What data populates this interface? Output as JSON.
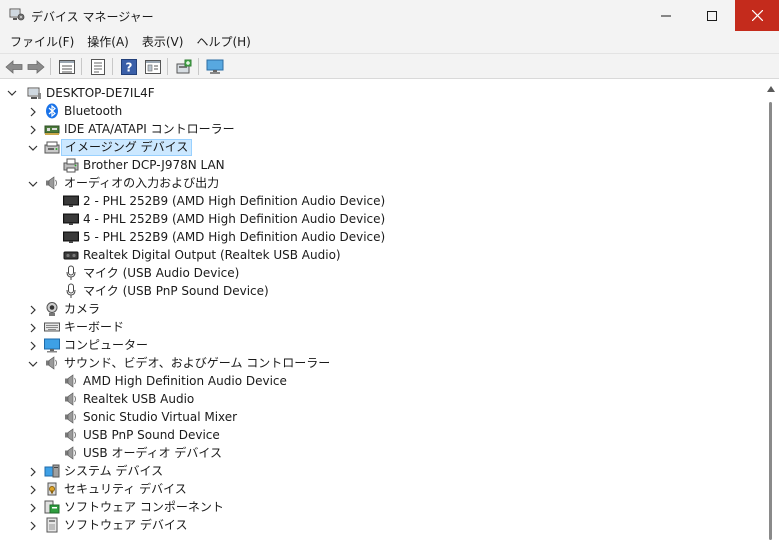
{
  "window": {
    "title": "デバイス マネージャー"
  },
  "menu": [
    "ファイル(F)",
    "操作(A)",
    "表示(V)",
    "ヘルプ(H)"
  ],
  "toolbar": [
    "back-icon",
    "forward-icon",
    "properties-icon",
    "update-driver-icon",
    "help-icon",
    "view-icon",
    "scan-hardware-icon",
    "monitor-icon"
  ],
  "tree": {
    "root": {
      "label": "DESKTOP-DE7IL4F",
      "icon": "computer-icon"
    },
    "items": [
      {
        "label": "Bluetooth",
        "level": 1,
        "expander": "collapsed",
        "icon": "bluetooth-icon"
      },
      {
        "label": "IDE ATA/ATAPI コントローラー",
        "level": 1,
        "expander": "collapsed",
        "icon": "ide-controller-icon"
      },
      {
        "label": "イメージング デバイス",
        "level": 1,
        "expander": "expanded",
        "icon": "imaging-device-icon",
        "selected": true
      },
      {
        "label": "Brother DCP-J978N LAN",
        "level": 2,
        "expander": "none",
        "icon": "printer-icon"
      },
      {
        "label": "オーディオの入力および出力",
        "level": 1,
        "expander": "expanded",
        "icon": "speaker-icon"
      },
      {
        "label": "2 - PHL 252B9 (AMD High Definition Audio Device)",
        "level": 2,
        "expander": "none",
        "icon": "monitor-audio-icon"
      },
      {
        "label": "4 - PHL 252B9 (AMD High Definition Audio Device)",
        "level": 2,
        "expander": "none",
        "icon": "monitor-audio-icon"
      },
      {
        "label": "5 - PHL 252B9 (AMD High Definition Audio Device)",
        "level": 2,
        "expander": "none",
        "icon": "monitor-audio-icon"
      },
      {
        "label": "Realtek Digital Output (Realtek USB Audio)",
        "level": 2,
        "expander": "none",
        "icon": "digital-output-icon"
      },
      {
        "label": "マイク (USB Audio Device)",
        "level": 2,
        "expander": "none",
        "icon": "microphone-icon"
      },
      {
        "label": "マイク (USB PnP Sound Device)",
        "level": 2,
        "expander": "none",
        "icon": "microphone-icon"
      },
      {
        "label": "カメラ",
        "level": 1,
        "expander": "collapsed",
        "icon": "camera-icon"
      },
      {
        "label": "キーボード",
        "level": 1,
        "expander": "collapsed",
        "icon": "keyboard-icon"
      },
      {
        "label": "コンピューター",
        "level": 1,
        "expander": "collapsed",
        "icon": "computer-display-icon"
      },
      {
        "label": "サウンド、ビデオ、およびゲーム コントローラー",
        "level": 1,
        "expander": "expanded",
        "icon": "speaker-icon"
      },
      {
        "label": "AMD High Definition Audio Device",
        "level": 2,
        "expander": "none",
        "icon": "speaker-icon"
      },
      {
        "label": "Realtek USB Audio",
        "level": 2,
        "expander": "none",
        "icon": "speaker-icon"
      },
      {
        "label": "Sonic Studio Virtual Mixer",
        "level": 2,
        "expander": "none",
        "icon": "speaker-icon"
      },
      {
        "label": "USB PnP Sound Device",
        "level": 2,
        "expander": "none",
        "icon": "speaker-icon"
      },
      {
        "label": "USB オーディオ デバイス",
        "level": 2,
        "expander": "none",
        "icon": "speaker-icon"
      },
      {
        "label": "システム デバイス",
        "level": 1,
        "expander": "collapsed",
        "icon": "system-device-icon"
      },
      {
        "label": "セキュリティ デバイス",
        "level": 1,
        "expander": "collapsed",
        "icon": "security-device-icon"
      },
      {
        "label": "ソフトウェア コンポーネント",
        "level": 1,
        "expander": "collapsed",
        "icon": "software-component-icon"
      },
      {
        "label": "ソフトウェア デバイス",
        "level": 1,
        "expander": "collapsed",
        "icon": "software-device-icon"
      }
    ]
  }
}
